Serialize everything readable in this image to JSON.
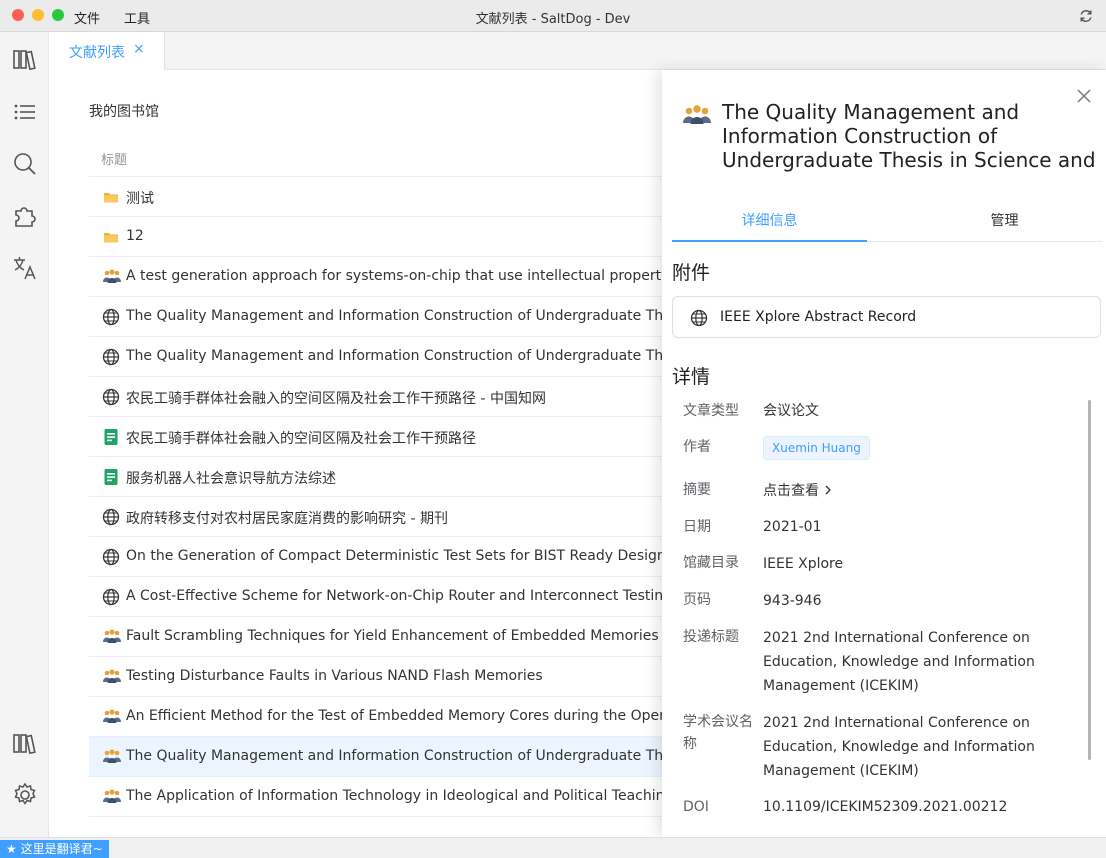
{
  "window": {
    "title": "文献列表 - SaltDog - Dev",
    "menu": [
      "文件",
      "工具"
    ],
    "traffic_colors": [
      "#fe5f57",
      "#febc2e",
      "#28c840"
    ]
  },
  "rail": {
    "top_icons": [
      "library-icon",
      "list-icon",
      "search-icon",
      "puzzle-icon",
      "translate-icon"
    ],
    "bottom_icons": [
      "library-icon",
      "settings-icon"
    ]
  },
  "tab": {
    "label": "文献列表",
    "close": "×"
  },
  "library": {
    "title": "我的图书馆",
    "column_header": "标题",
    "items": [
      {
        "icon": "folder-icon",
        "title": "测试"
      },
      {
        "icon": "folder-icon",
        "title": "12"
      },
      {
        "icon": "people-icon",
        "title": "A test generation approach for systems-on-chip that use intellectual property core"
      },
      {
        "icon": "globe-icon",
        "title": "The Quality Management and Information Construction of Undergraduate Thesis in"
      },
      {
        "icon": "globe-icon",
        "title": "The Quality Management and Information Construction of Undergraduate Thesis in"
      },
      {
        "icon": "globe-icon",
        "title": "农民工骑手群体社会融入的空间区隔及社会工作干预路径 - 中国知网"
      },
      {
        "icon": "doc-icon",
        "title": "农民工骑手群体社会融入的空间区隔及社会工作干预路径"
      },
      {
        "icon": "doc-icon",
        "title": "服务机器人社会意识导航方法综述"
      },
      {
        "icon": "globe-icon",
        "title": "政府转移支付对农村居民家庭消费的影响研究 - 期刊"
      },
      {
        "icon": "globe-icon",
        "title": "On the Generation of Compact Deterministic Test Sets for BIST Ready Designs | IE"
      },
      {
        "icon": "globe-icon",
        "title": "A Cost-Effective Scheme for Network-on-Chip Router and Interconnect Testing | I"
      },
      {
        "icon": "people-icon",
        "title": "Fault Scrambling Techniques for Yield Enhancement of Embedded Memories"
      },
      {
        "icon": "people-icon",
        "title": "Testing Disturbance Faults in Various NAND Flash Memories"
      },
      {
        "icon": "people-icon",
        "title": "An Efficient Method for the Test of Embedded Memory Cores during the Operation"
      },
      {
        "icon": "people-icon",
        "title": "The Quality Management and Information Construction of Undergraduate Thesis in",
        "selected": true
      },
      {
        "icon": "people-icon",
        "title": "The Application of Information Technology in Ideological and Political Teaching in"
      }
    ]
  },
  "detail": {
    "title_lines": [
      "The Quality Management and",
      "Information Construction of",
      "Undergraduate Thesis in Science and…"
    ],
    "tabs": [
      "详细信息",
      "管理"
    ],
    "attachments_heading": "附件",
    "attachment": "IEEE Xplore Abstract Record",
    "details_heading": "详情",
    "fields": {
      "type_label": "文章类型",
      "type_value": "会议论文",
      "author_label": "作者",
      "author_value": "Xuemin Huang",
      "abstract_label": "摘要",
      "abstract_value": "点击查看",
      "date_label": "日期",
      "date_value": "2021-01",
      "catalog_label": "馆藏目录",
      "catalog_value": "IEEE Xplore",
      "pages_label": "页码",
      "pages_value": "943-946",
      "proc_label": "投递标题",
      "proc_value_lines": [
        "2021 2nd International Conference on",
        "Education, Knowledge and Information",
        "Management (ICEKIM)"
      ],
      "conf_label_lines": [
        "学术会议名",
        "称"
      ],
      "conf_value_lines": [
        "2021 2nd International Conference on",
        "Education, Knowledge and Information",
        "Management (ICEKIM)"
      ],
      "doi_label": "DOI",
      "doi_value": "10.1109/ICEKIM52309.2021.00212"
    }
  },
  "status": {
    "badge": "★ 这里是翻译君~"
  },
  "colors": {
    "accent": "#409eff",
    "selected_row": "#ecf5ff"
  }
}
